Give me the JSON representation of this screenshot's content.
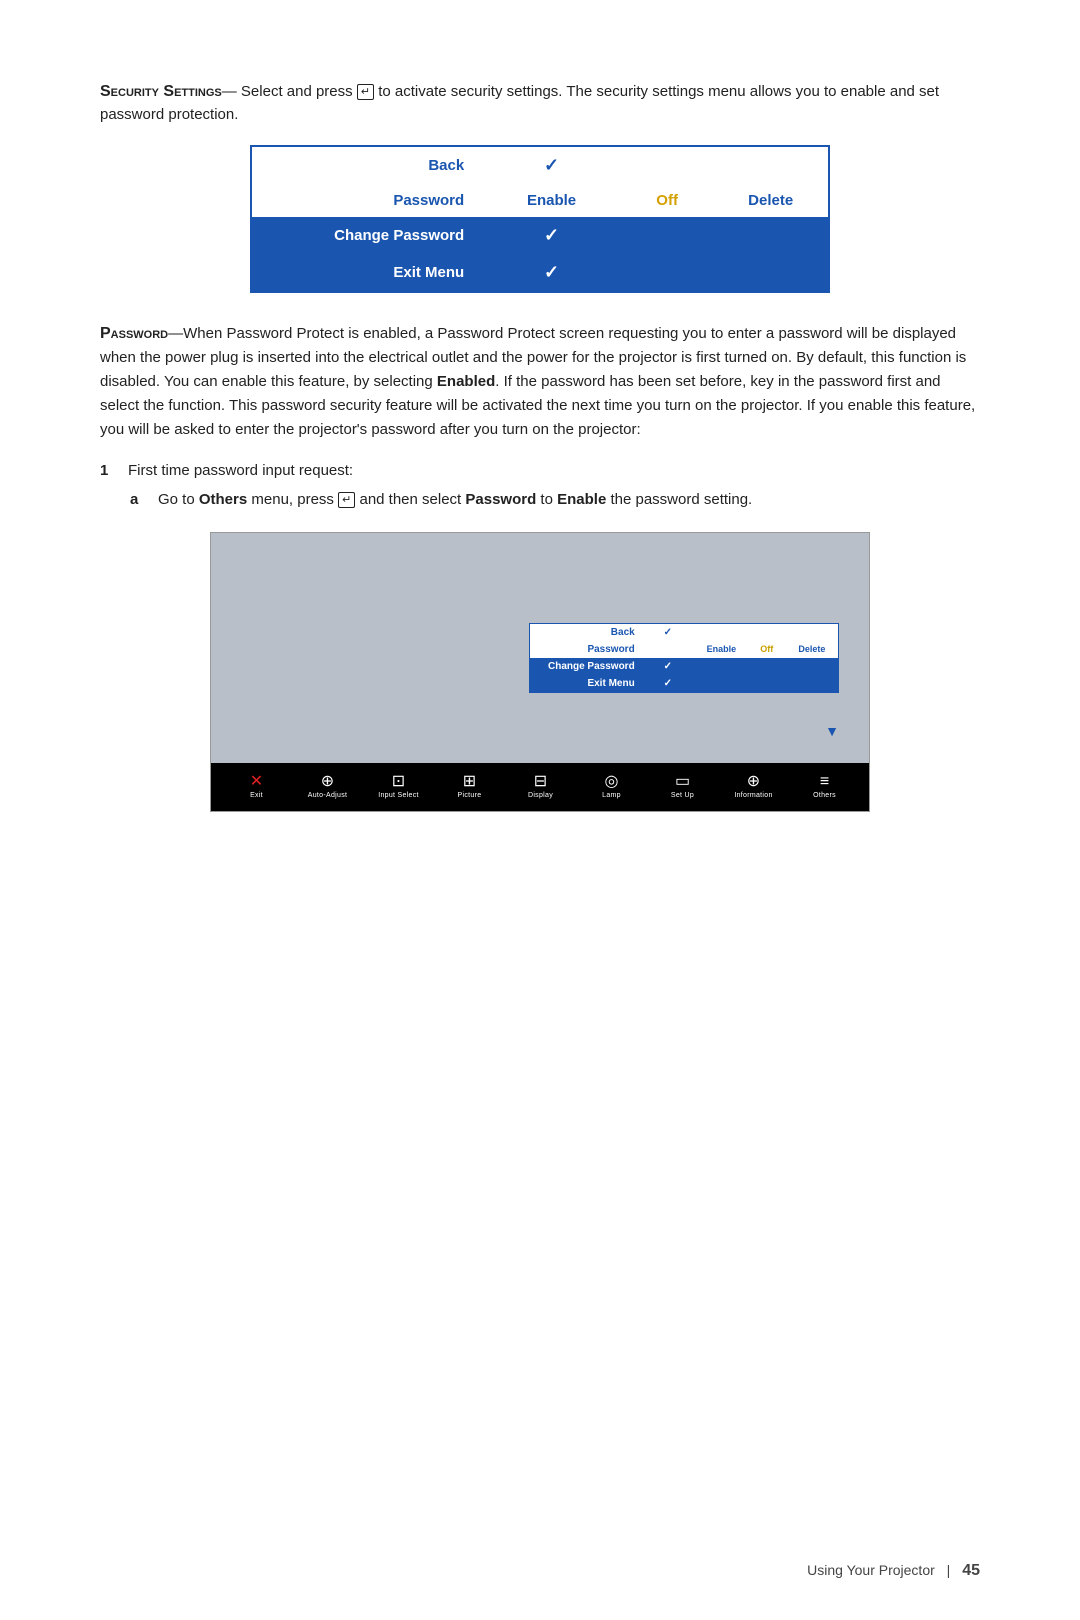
{
  "page": {
    "footer_text": "Using Your Projector",
    "page_number": "45"
  },
  "intro": {
    "heading": "Security Settings",
    "dash": "—",
    "body": "Select and press",
    "body2": "to activate security settings. The security settings menu allows you to enable and set password protection."
  },
  "security_menu": {
    "rows": [
      {
        "label": "Back",
        "col2": "✓",
        "col3": "",
        "col4": "",
        "col5": "",
        "type": "white"
      },
      {
        "label": "Password",
        "col2": "Enable",
        "col3": "Off",
        "col4": "Delete",
        "col5": "",
        "type": "white-password"
      },
      {
        "label": "Change Password",
        "col2": "✓",
        "col3": "",
        "col4": "",
        "col5": "",
        "type": "blue"
      },
      {
        "label": "Exit Menu",
        "col2": "✓",
        "col3": "",
        "col4": "",
        "col5": "",
        "type": "blue"
      }
    ]
  },
  "password_section": {
    "heading": "Password",
    "dash": "—",
    "body": "When Password Protect is enabled, a Password Protect screen requesting you to enter a password will be displayed when the power plug is inserted into the electrical outlet and the power for the projector is first turned on. By default, this function is disabled. You can enable this feature, by selecting",
    "enabled_word": "Enabled",
    "body2": ". If the password has been set before, key in the password first and select the function. This password security feature will be activated the next time you turn on the projector. If you enable this feature, you will be asked to enter the projector's password after you turn on the projector:"
  },
  "list": {
    "item1_num": "1",
    "item1_text": "First time password input request:",
    "item_a_letter": "a",
    "item_a_pre": "Go to",
    "item_a_others": "Others",
    "item_a_mid": "menu, press",
    "item_a_post": "and then select",
    "item_a_password": "Password",
    "item_a_to": "to",
    "item_a_enable": "Enable",
    "item_a_end": "the password setting."
  },
  "mini_menu": {
    "rows": [
      {
        "label": "Back",
        "check": "✓",
        "enable": "",
        "off": "",
        "delete": "",
        "type": "white"
      },
      {
        "label": "Password",
        "check": "",
        "enable": "Enable",
        "off": "Off",
        "delete": "Delete",
        "type": "white-password"
      },
      {
        "label": "Change Password",
        "check": "✓",
        "enable": "",
        "off": "",
        "delete": "",
        "type": "blue"
      },
      {
        "label": "Exit Menu",
        "check": "✓",
        "enable": "",
        "off": "",
        "delete": "",
        "type": "blue"
      }
    ]
  },
  "toolbar": {
    "items": [
      {
        "icon": "✕",
        "label": "Exit",
        "color": "red"
      },
      {
        "icon": "⊕",
        "label": "Auto-Adjust",
        "color": "white"
      },
      {
        "icon": "⊡",
        "label": "Input Select",
        "color": "white"
      },
      {
        "icon": "⊞",
        "label": "Picture",
        "color": "white"
      },
      {
        "icon": "⊟",
        "label": "Display",
        "color": "white"
      },
      {
        "icon": "◎",
        "label": "Lamp",
        "color": "white"
      },
      {
        "icon": "▭",
        "label": "Set Up",
        "color": "white"
      },
      {
        "icon": "⊕",
        "label": "Information",
        "color": "white"
      },
      {
        "icon": "≡",
        "label": "Others",
        "color": "white"
      }
    ]
  }
}
